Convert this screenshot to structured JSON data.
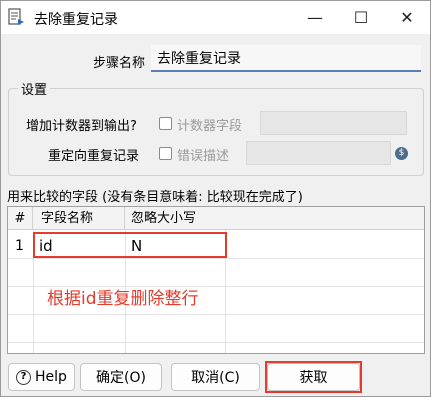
{
  "window": {
    "title": "去除重复记录",
    "minimize": "—",
    "maximize": "☐",
    "close": "✕"
  },
  "step_name": {
    "label": "步骤名称",
    "value": "去除重复记录"
  },
  "settings": {
    "title": "设置",
    "counter_label": "增加计数器到输出?",
    "counter_field_label": "计数器字段",
    "redirect_label": "重定向重复记录",
    "error_desc_label": "错误描述"
  },
  "fields": {
    "label": "用来比较的字段 (没有条目意味着: 比较现在完成了)",
    "columns": [
      "#",
      "字段名称",
      "忽略大小写"
    ],
    "rows": [
      {
        "num": "1",
        "field": "id",
        "ignore_case": "N"
      }
    ],
    "annotation": "根据id重复删除整行"
  },
  "buttons": {
    "help": "Help",
    "ok": "确定(O)",
    "cancel": "取消(C)",
    "get": "获取"
  },
  "colors": {
    "accent": "#5a7fb8",
    "highlight": "#e53b2c"
  }
}
